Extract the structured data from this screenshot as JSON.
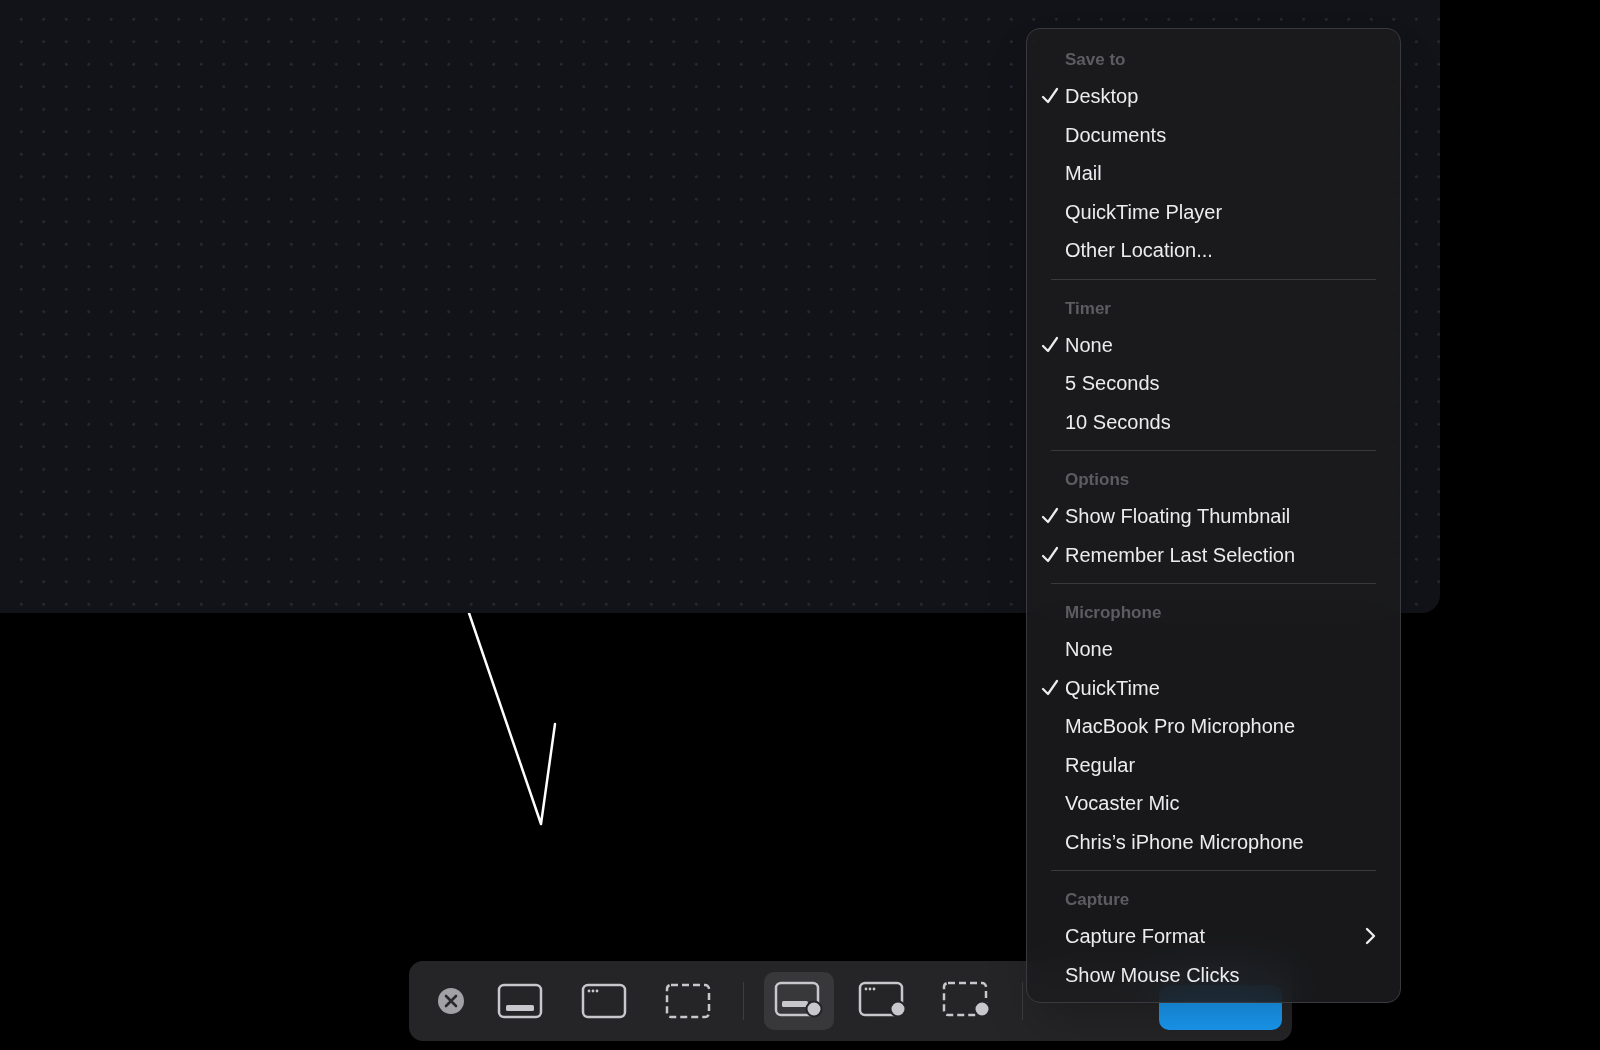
{
  "toolbar": {
    "tools": [
      {
        "kind": "close",
        "selected": false
      },
      {
        "kind": "capture-screen",
        "selected": false
      },
      {
        "kind": "capture-window",
        "selected": false
      },
      {
        "kind": "capture-selection",
        "selected": false
      },
      {
        "kind": "record-screen",
        "selected": true
      },
      {
        "kind": "record-window",
        "selected": false
      },
      {
        "kind": "record-selection",
        "selected": false
      }
    ]
  },
  "menu": {
    "sections": [
      {
        "header": "Save to",
        "items": [
          {
            "label": "Desktop",
            "checked": true
          },
          {
            "label": "Documents",
            "checked": false
          },
          {
            "label": "Mail",
            "checked": false
          },
          {
            "label": "QuickTime Player",
            "checked": false
          },
          {
            "label": "Other Location...",
            "checked": false
          }
        ]
      },
      {
        "header": "Timer",
        "items": [
          {
            "label": "None",
            "checked": true
          },
          {
            "label": "5 Seconds",
            "checked": false
          },
          {
            "label": "10 Seconds",
            "checked": false
          }
        ]
      },
      {
        "header": "Options",
        "items": [
          {
            "label": "Show Floating Thumbnail",
            "checked": true
          },
          {
            "label": "Remember Last Selection",
            "checked": true
          }
        ]
      },
      {
        "header": "Microphone",
        "items": [
          {
            "label": "None",
            "checked": false
          },
          {
            "label": "QuickTime",
            "checked": true
          },
          {
            "label": "MacBook Pro Microphone",
            "checked": false
          },
          {
            "label": "Regular",
            "checked": false
          },
          {
            "label": "Vocaster Mic",
            "checked": false
          },
          {
            "label": "Chris’s iPhone Microphone",
            "checked": false
          }
        ]
      },
      {
        "header": "Capture",
        "items": [
          {
            "label": "Capture Format",
            "checked": false,
            "submenu": true
          },
          {
            "label": "Show Mouse Clicks",
            "checked": false
          }
        ]
      }
    ]
  }
}
